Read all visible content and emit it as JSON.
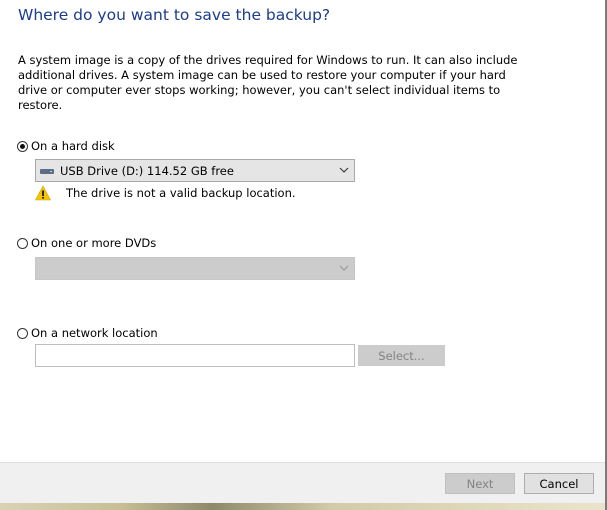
{
  "heading": "Where do you want to save the backup?",
  "description": "A system image is a copy of the drives required for Windows to run. It can also include additional drives. A system image can be used to restore your computer if your hard drive or computer ever stops working; however, you can't select individual items to restore.",
  "options": {
    "hard_disk": {
      "label": "On a hard disk",
      "selected": true,
      "drive_icon": "usb-drive-icon",
      "selected_value": "USB Drive (D:)  114.52 GB free",
      "warning_icon": "warning-icon",
      "warning": "The drive is not a valid backup location."
    },
    "dvds": {
      "label": "On one or more DVDs",
      "selected": false,
      "selected_value": ""
    },
    "network": {
      "label": "On a network location",
      "selected": false,
      "path_value": "",
      "select_button": "Select..."
    }
  },
  "footer": {
    "next_label": "Next",
    "cancel_label": "Cancel"
  },
  "colors": {
    "heading": "#1b3d8c",
    "footer_bg": "#f0f0f0",
    "warning": "#f5c400"
  }
}
